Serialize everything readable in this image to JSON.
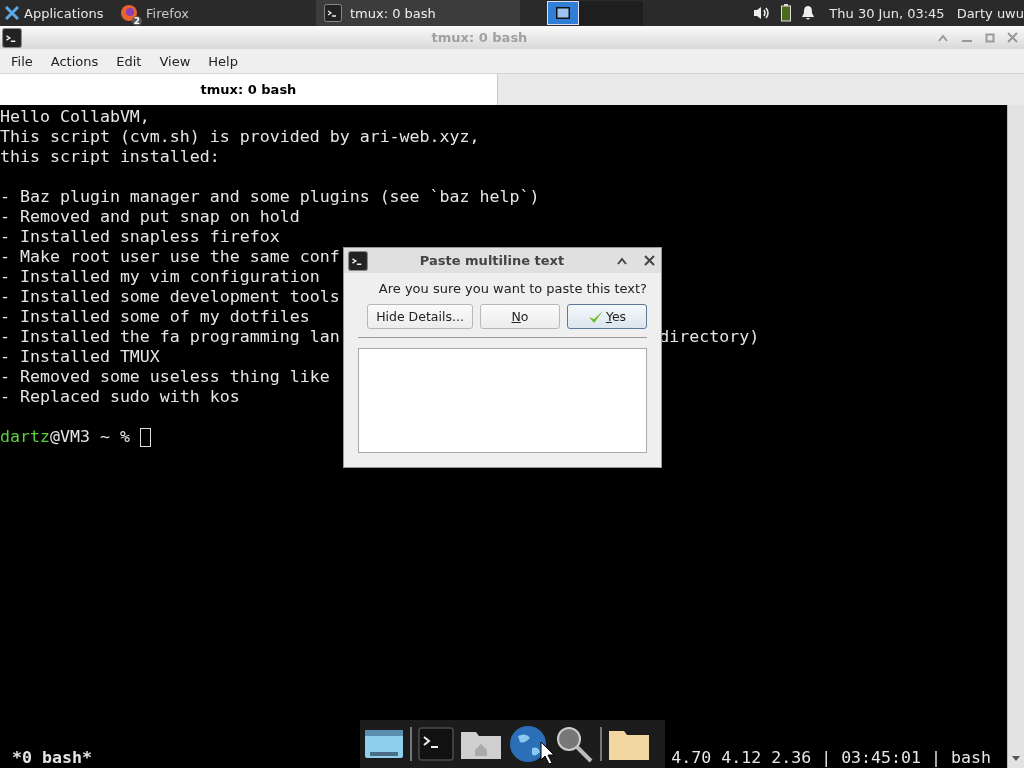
{
  "top_panel": {
    "applications": "Applications",
    "tasks": [
      {
        "label": "Firefox",
        "badge": "2",
        "selected": false
      },
      {
        "label": "tmux: 0 bash",
        "selected": true
      }
    ],
    "workspaces": [
      {
        "selected": true
      },
      {
        "selected": false
      },
      {
        "selected": false
      }
    ],
    "clock": "Thu 30 Jun, 03:45",
    "user": "Darty uwu"
  },
  "window": {
    "title": "tmux: 0 bash",
    "menu": [
      "File",
      "Actions",
      "Edit",
      "View",
      "Help"
    ],
    "tabs": [
      {
        "label": "tmux: 0 bash",
        "selected": true
      }
    ]
  },
  "terminal": {
    "lines": [
      {
        "text": "Hello CollabVM,"
      },
      {
        "text": "This script (cvm.sh) is provided by ari-web.xyz,"
      },
      {
        "text": "this script installed:"
      },
      {
        "kind": "blank"
      },
      {
        "text": "- Baz plugin manager and some plugins (see `baz help`)"
      },
      {
        "text": "- Removed and put snap on hold"
      },
      {
        "text": "- Installed snapless firefox"
      },
      {
        "text": "- Make root user use the same conf"
      },
      {
        "text": "- Installed my vim configuration"
      },
      {
        "text": "- Installed some development tools"
      },
      {
        "text": "- Installed some of my dotfiles"
      },
      {
        "text": "- Installed the fa programming lan",
        "tail": "directory)"
      },
      {
        "text": "- Installed TMUX"
      },
      {
        "text": "- Removed some useless thing like"
      },
      {
        "text": "- Replaced sudo with kos"
      },
      {
        "kind": "blank"
      }
    ],
    "prompt": {
      "user": "dartz",
      "rest": "@VM3 ~ % "
    },
    "status_left": "*0 bash*",
    "status_right": "4.70 4.12 2.36 | 03:45:01 | bash"
  },
  "dialog": {
    "title": "Paste multiline text",
    "message": "Are you sure you want to paste this text?",
    "buttons": [
      {
        "label": "Hide Details...",
        "mnemonic": false,
        "default": false,
        "kind": "plain"
      },
      {
        "label": "No",
        "mnemonic": true,
        "default": false,
        "kind": "plain"
      },
      {
        "label": "Yes",
        "mnemonic": true,
        "default": true,
        "kind": "check"
      }
    ]
  }
}
